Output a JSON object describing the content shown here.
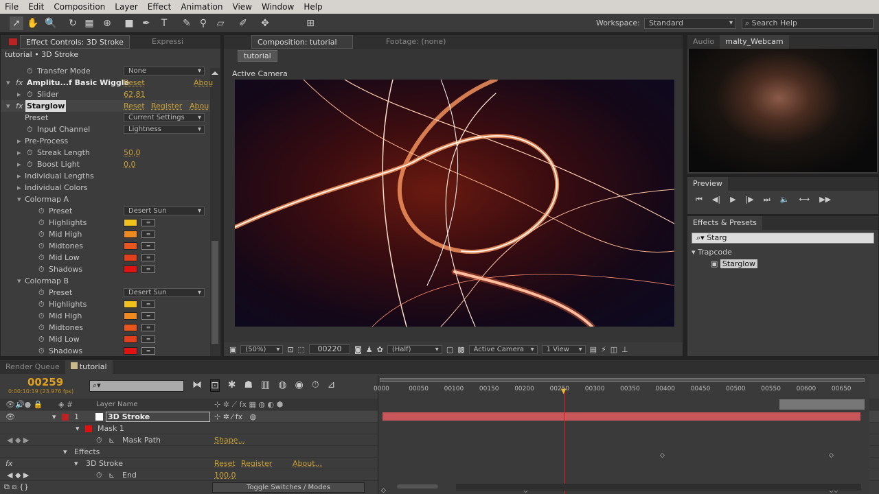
{
  "menu": [
    "File",
    "Edit",
    "Composition",
    "Layer",
    "Effect",
    "Animation",
    "View",
    "Window",
    "Help"
  ],
  "workspace": {
    "label": "Workspace:",
    "value": "Standard",
    "search_placeholder": "Search Help"
  },
  "effect_controls": {
    "tab": "Effect Controls: 3D Stroke",
    "tab2": "Expressi",
    "breadcrumb": "tutorial • 3D Stroke",
    "transfer_mode": {
      "label": "Transfer Mode",
      "value": "None"
    },
    "wiggle": {
      "label": "Amplitu...f Basic Wiggle",
      "reset": "Reset",
      "about": "Abou"
    },
    "slider": {
      "label": "Slider",
      "value": "62,81"
    },
    "starglow": {
      "label": "Starglow",
      "reset": "Reset",
      "register": "Register",
      "about": "Abou"
    },
    "preset": {
      "label": "Preset",
      "value": "Current Settings"
    },
    "input_channel": {
      "label": "Input Channel",
      "value": "Lightness"
    },
    "pre_process": "Pre-Process",
    "streak_length": {
      "label": "Streak Length",
      "value": "50,0"
    },
    "boost_light": {
      "label": "Boost Light",
      "value": "0,0"
    },
    "individual_lengths": "Individual Lengths",
    "individual_colors": "Individual Colors",
    "colormap_a": {
      "label": "Colormap A",
      "preset_label": "Preset",
      "preset": "Desert Sun",
      "colors": [
        {
          "label": "Highlights",
          "color": "#f2c21c"
        },
        {
          "label": "Mid High",
          "color": "#f08a1e"
        },
        {
          "label": "Midtones",
          "color": "#e8561e"
        },
        {
          "label": "Mid Low",
          "color": "#e2401c"
        },
        {
          "label": "Shadows",
          "color": "#e01212"
        }
      ]
    },
    "colormap_b": {
      "label": "Colormap B",
      "preset_label": "Preset",
      "preset": "Desert Sun",
      "colors": [
        {
          "label": "Highlights",
          "color": "#f2c21c"
        },
        {
          "label": "Mid High",
          "color": "#f08a1e"
        },
        {
          "label": "Midtones",
          "color": "#e8561e"
        },
        {
          "label": "Mid Low",
          "color": "#e2401c"
        },
        {
          "label": "Shadows",
          "color": "#e01212"
        }
      ]
    }
  },
  "composition": {
    "tab": "Composition: tutorial",
    "footage_tab": "Footage: (none)",
    "comp_button": "tutorial",
    "camera_label": "Active Camera",
    "zoom": "(50%)",
    "timecode": "00220",
    "resolution": "(Half)",
    "camera": "Active Camera",
    "views": "1 View"
  },
  "audio_tab": "Audio",
  "webcam_tab": "malty_Webcam",
  "preview": {
    "title": "Preview"
  },
  "effects_presets": {
    "title": "Effects & Presets",
    "search": "Starg",
    "category": "Trapcode",
    "item": "Starglow"
  },
  "timeline": {
    "render_queue": "Render Queue",
    "tab": "tutorial",
    "current_frame": "00259",
    "timecode_sub": "0:00:10:19 (23.976 fps)",
    "layer_name_header": "Layer Name",
    "layer": {
      "number": "1",
      "name": "3D Stroke"
    },
    "mask": "Mask 1",
    "mask_path": {
      "label": "Mask Path",
      "value": "Shape..."
    },
    "effects": "Effects",
    "stroke_effect": {
      "label": "3D Stroke",
      "reset": "Reset",
      "register": "Register",
      "about": "About..."
    },
    "end": {
      "label": "End",
      "value": "100,0"
    },
    "toggle": "Toggle Switches / Modes",
    "ruler": [
      "0000",
      "00050",
      "00100",
      "00150",
      "00200",
      "00250",
      "00300",
      "00350",
      "00400",
      "00450",
      "00500",
      "00550",
      "00600",
      "00650"
    ],
    "current_time_frame": 259
  }
}
